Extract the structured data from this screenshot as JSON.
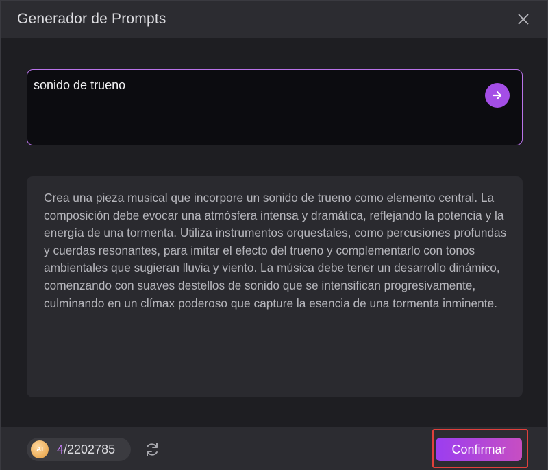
{
  "dialog": {
    "title": "Generador de Prompts",
    "close_icon": "close-icon"
  },
  "input": {
    "value": "sonido de trueno",
    "send_icon": "arrow-right-icon",
    "accent_color": "#b873e8"
  },
  "result": {
    "text": "Crea una pieza musical que incorpore un sonido de trueno como elemento central. La composición debe evocar una atmósfera intensa y dramática, reflejando la potencia y la energía de una tormenta. Utiliza instrumentos orquestales, como percusiones profundas y cuerdas resonantes, para imitar el efecto del trueno y complementarlo con tonos ambientales que sugieran lluvia y viento. La música debe tener un desarrollo dinámico, comenzando con suaves destellos de sonido que se intensifican progresivamente, culminando en un clímax poderoso que capture la esencia de una tormenta inminente."
  },
  "footer": {
    "coin_icon": "ai-coin-icon",
    "coin_label": "AI",
    "credits_used": "4",
    "credits_total": "/2202785",
    "refresh_icon": "refresh-icon",
    "confirm_label": "Confirmar",
    "highlight_color": "#e0403c"
  }
}
